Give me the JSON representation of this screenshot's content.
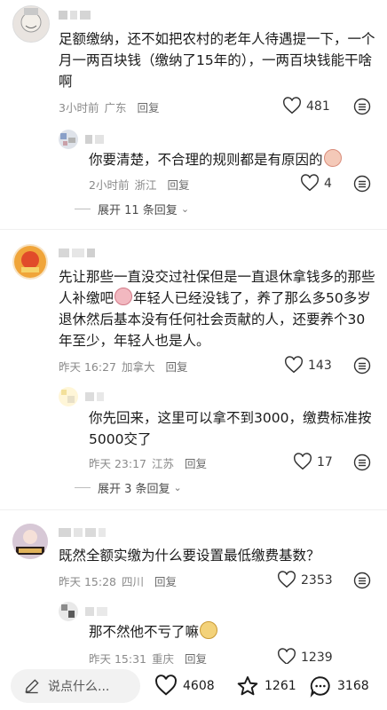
{
  "comments": [
    {
      "text_lines": [
        "足额缴纳，还不如把农村的老年人待遇提一下，一个",
        "月一两百块钱（缴纳了15年的），一两百块钱能干啥",
        "啊"
      ],
      "time": "3小时前",
      "location": "广东",
      "reply": "回复",
      "likes": "481",
      "replies": [
        {
          "text": "你要清楚，不合理的规则都是有原因的",
          "time": "2小时前",
          "location": "浙江",
          "reply": "回复",
          "likes": "4"
        }
      ],
      "expand": "展开 11 条回复"
    },
    {
      "text_lines": [
        "先让那些一直没交过社保但是一直退休拿钱多的那些",
        "人补缴吧",
        "年轻人已经没钱了，养了那么多50多岁",
        "退休然后基本没有任何社会贡献的人，还要养个30",
        "年至少，年轻人也是人。"
      ],
      "time": "昨天 16:27",
      "location": "加拿大",
      "reply": "回复",
      "likes": "143",
      "replies": [
        {
          "text_lines": [
            "你先回来，这里可以拿不到3000，缴费标准按",
            "5000交了"
          ],
          "time": "昨天 23:17",
          "location": "江苏",
          "reply": "回复",
          "likes": "17"
        }
      ],
      "expand": "展开 3 条回复"
    },
    {
      "text_lines": [
        "既然全额实缴为什么要设置最低缴费基数？"
      ],
      "time": "昨天 15:28",
      "location": "四川",
      "reply": "回复",
      "likes": "2353",
      "replies": [
        {
          "text": "那不然他不亏了嘛",
          "time": "昨天 15:31",
          "location": "重庆",
          "reply": "回复",
          "likes": "1239"
        }
      ]
    }
  ],
  "bottom_bar": {
    "input_placeholder": "说点什么...",
    "likes": "4608",
    "favorites": "1261",
    "comments": "3168"
  },
  "icons": [
    "heart-icon",
    "more-icon",
    "pencil-icon",
    "star-icon",
    "comment-icon",
    "chevron-down-icon"
  ]
}
